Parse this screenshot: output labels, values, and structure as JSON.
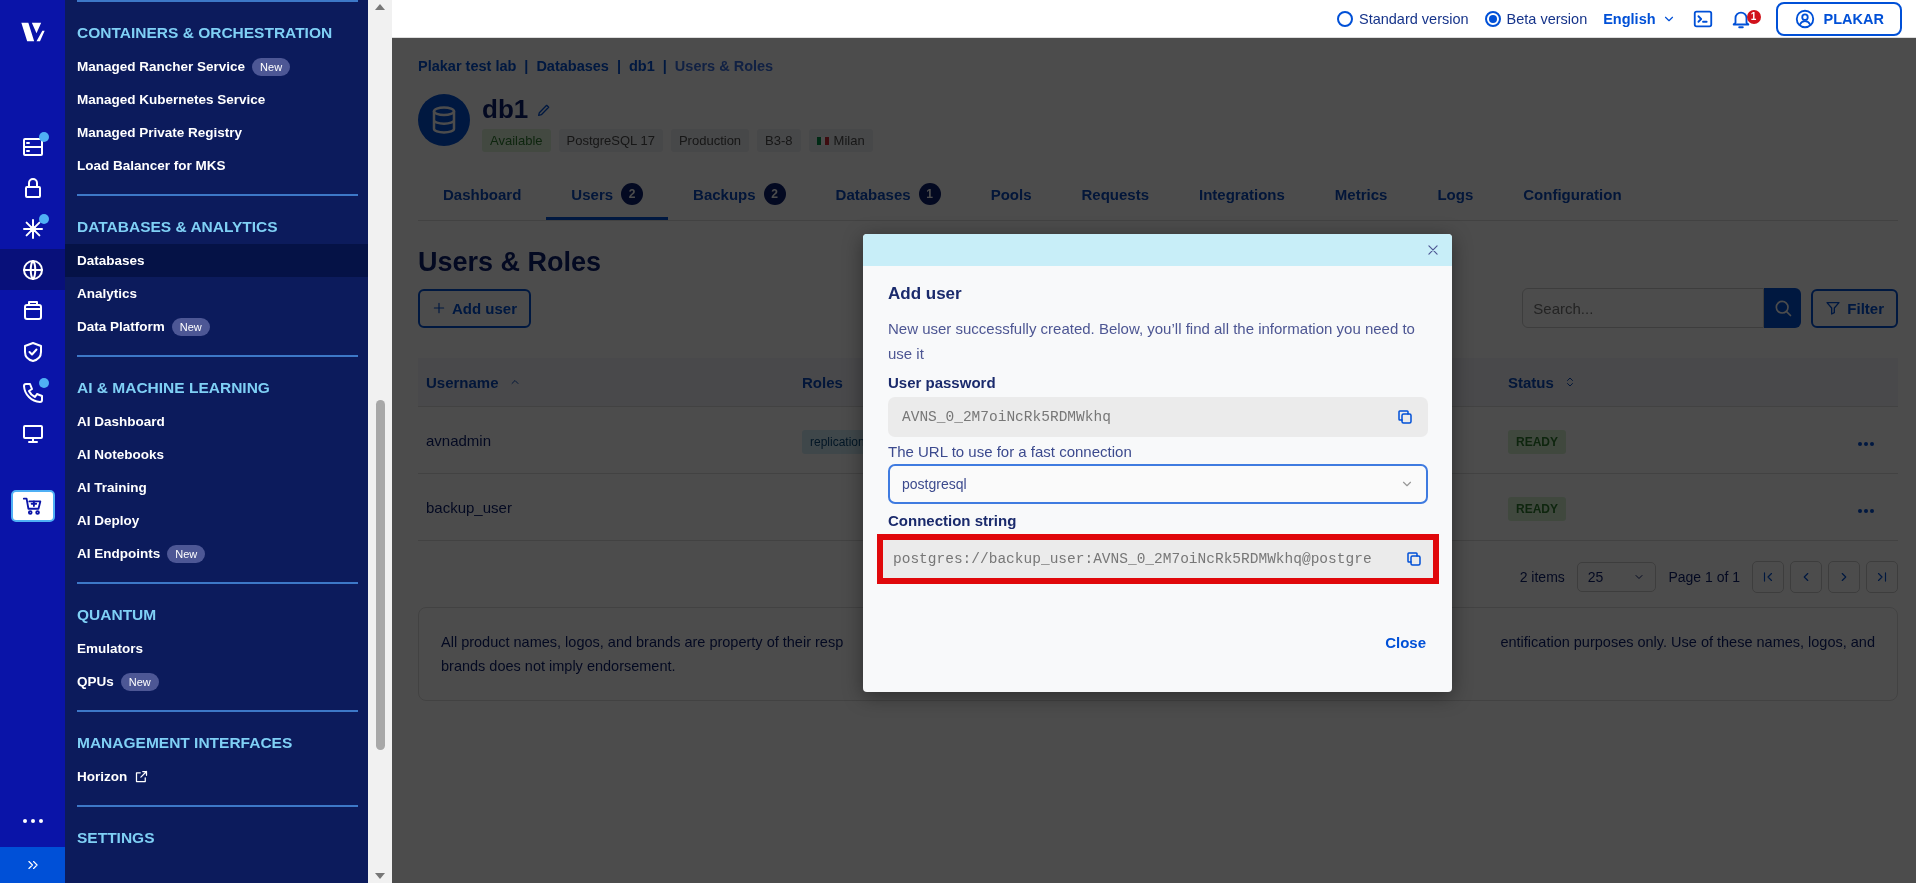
{
  "rail": {
    "items": [
      {
        "kind": "server",
        "notification_dot": true,
        "selected": false
      },
      {
        "kind": "lock",
        "notification_dot": false,
        "selected": false
      },
      {
        "kind": "network",
        "notification_dot": true,
        "selected": false
      },
      {
        "kind": "globe",
        "notification_dot": false,
        "selected": true
      },
      {
        "kind": "box",
        "notification_dot": false,
        "selected": false
      },
      {
        "kind": "shield",
        "notification_dot": false,
        "selected": false
      },
      {
        "kind": "phone",
        "notification_dot": true,
        "selected": false
      },
      {
        "kind": "monitor",
        "notification_dot": false,
        "selected": false
      }
    ]
  },
  "sidebar": {
    "sections": [
      {
        "title": "CONTAINERS & ORCHESTRATION",
        "items": [
          {
            "label": "Managed Rancher Service",
            "badge": "New",
            "selected": false,
            "external": false
          },
          {
            "label": "Managed Kubernetes Service",
            "selected": false,
            "external": false
          },
          {
            "label": "Managed Private Registry",
            "selected": false,
            "external": false
          },
          {
            "label": "Load Balancer for MKS",
            "selected": false,
            "external": false
          }
        ]
      },
      {
        "title": "DATABASES & ANALYTICS",
        "items": [
          {
            "label": "Databases",
            "selected": true,
            "external": false
          },
          {
            "label": "Analytics",
            "selected": false,
            "external": false
          },
          {
            "label": "Data Platform",
            "badge": "New",
            "selected": false,
            "external": false
          }
        ]
      },
      {
        "title": "AI & MACHINE LEARNING",
        "items": [
          {
            "label": "AI Dashboard",
            "selected": false,
            "external": false
          },
          {
            "label": "AI Notebooks",
            "selected": false,
            "external": false
          },
          {
            "label": "AI Training",
            "selected": false,
            "external": false
          },
          {
            "label": "AI Deploy",
            "selected": false,
            "external": false
          },
          {
            "label": "AI Endpoints",
            "badge": "New",
            "selected": false,
            "external": false
          }
        ]
      },
      {
        "title": "QUANTUM",
        "items": [
          {
            "label": "Emulators",
            "selected": false,
            "external": false
          },
          {
            "label": "QPUs",
            "badge": "New",
            "selected": false,
            "external": false
          }
        ]
      },
      {
        "title": "MANAGEMENT INTERFACES",
        "items": [
          {
            "label": "Horizon",
            "selected": false,
            "external": true
          }
        ]
      },
      {
        "title": "SETTINGS"
      }
    ]
  },
  "topbar": {
    "versions": [
      {
        "label": "Standard version",
        "selected": false
      },
      {
        "label": "Beta version",
        "selected": true
      }
    ],
    "language": "English",
    "notification_count": "1",
    "account": "PLAKAR"
  },
  "page": {
    "breadcrumb": [
      {
        "label": "Plakar test lab",
        "current": false
      },
      {
        "separator": "|",
        "label": "Databases",
        "current": false
      },
      {
        "separator": "|",
        "label": "db1",
        "current": false
      },
      {
        "separator": "|",
        "label": "Users & Roles",
        "current": true
      }
    ],
    "title": "db1",
    "tags": [
      {
        "label": "Available",
        "kind": "success",
        "flag": false
      },
      {
        "label": "PostgreSQL 17",
        "kind": "info",
        "flag": false
      },
      {
        "label": "Production",
        "kind": "info",
        "flag": false
      },
      {
        "label": "B3-8",
        "kind": "info",
        "flag": false
      },
      {
        "label": "Milan",
        "kind": "info",
        "flag": true
      }
    ],
    "tabs": [
      {
        "label": "Dashboard",
        "selected": false
      },
      {
        "label": "Users",
        "count": "2",
        "selected": true
      },
      {
        "label": "Backups",
        "count": "2",
        "selected": false
      },
      {
        "label": "Databases",
        "count": "1",
        "selected": false
      },
      {
        "label": "Pools",
        "selected": false
      },
      {
        "label": "Requests",
        "selected": false
      },
      {
        "label": "Integrations",
        "selected": false
      },
      {
        "label": "Metrics",
        "selected": false
      },
      {
        "label": "Logs",
        "selected": false
      },
      {
        "label": "Configuration",
        "selected": false
      }
    ],
    "section_title": "Users & Roles",
    "add_button": "Add user",
    "search": {
      "placeholder": "Search..."
    },
    "filter_button": "Filter",
    "table": {
      "columns": [
        {
          "label": "Username",
          "sorted_ascending": true,
          "sortable": true
        },
        {
          "label": "Roles",
          "sorted_ascending": false,
          "sortable": false
        },
        {
          "label": "Status",
          "sorted_ascending": false,
          "sortable": true
        }
      ],
      "rows": [
        {
          "username": "avnadmin",
          "role": "replication",
          "status": "READY"
        },
        {
          "username": "backup_user",
          "status": "READY"
        }
      ]
    },
    "pagination": {
      "items": "2 items",
      "page_size": "25",
      "page_label": "Page 1 of 1"
    },
    "note": {
      "left": "All product names, logos, and brands are property of their resp",
      "right": "entification purposes only. Use of these names, logos, and",
      "line_2": "brands does not imply endorsement."
    }
  },
  "modal": {
    "title": "Add user",
    "message": "New user successfully created. Below, you’ll find all the information you need to use it",
    "password_label": "User password",
    "password": "AVNS_0_2M7oiNcRk5RDMWkhq",
    "url_label": "The URL to use for a fast connection",
    "url_type": "postgresql",
    "connection_label": "Connection string",
    "connection": "postgres://backup_user:AVNS_0_2M7oiNcRk5RDMWkhq@postgre",
    "connection_highlighted": true,
    "close_button": "Close"
  }
}
